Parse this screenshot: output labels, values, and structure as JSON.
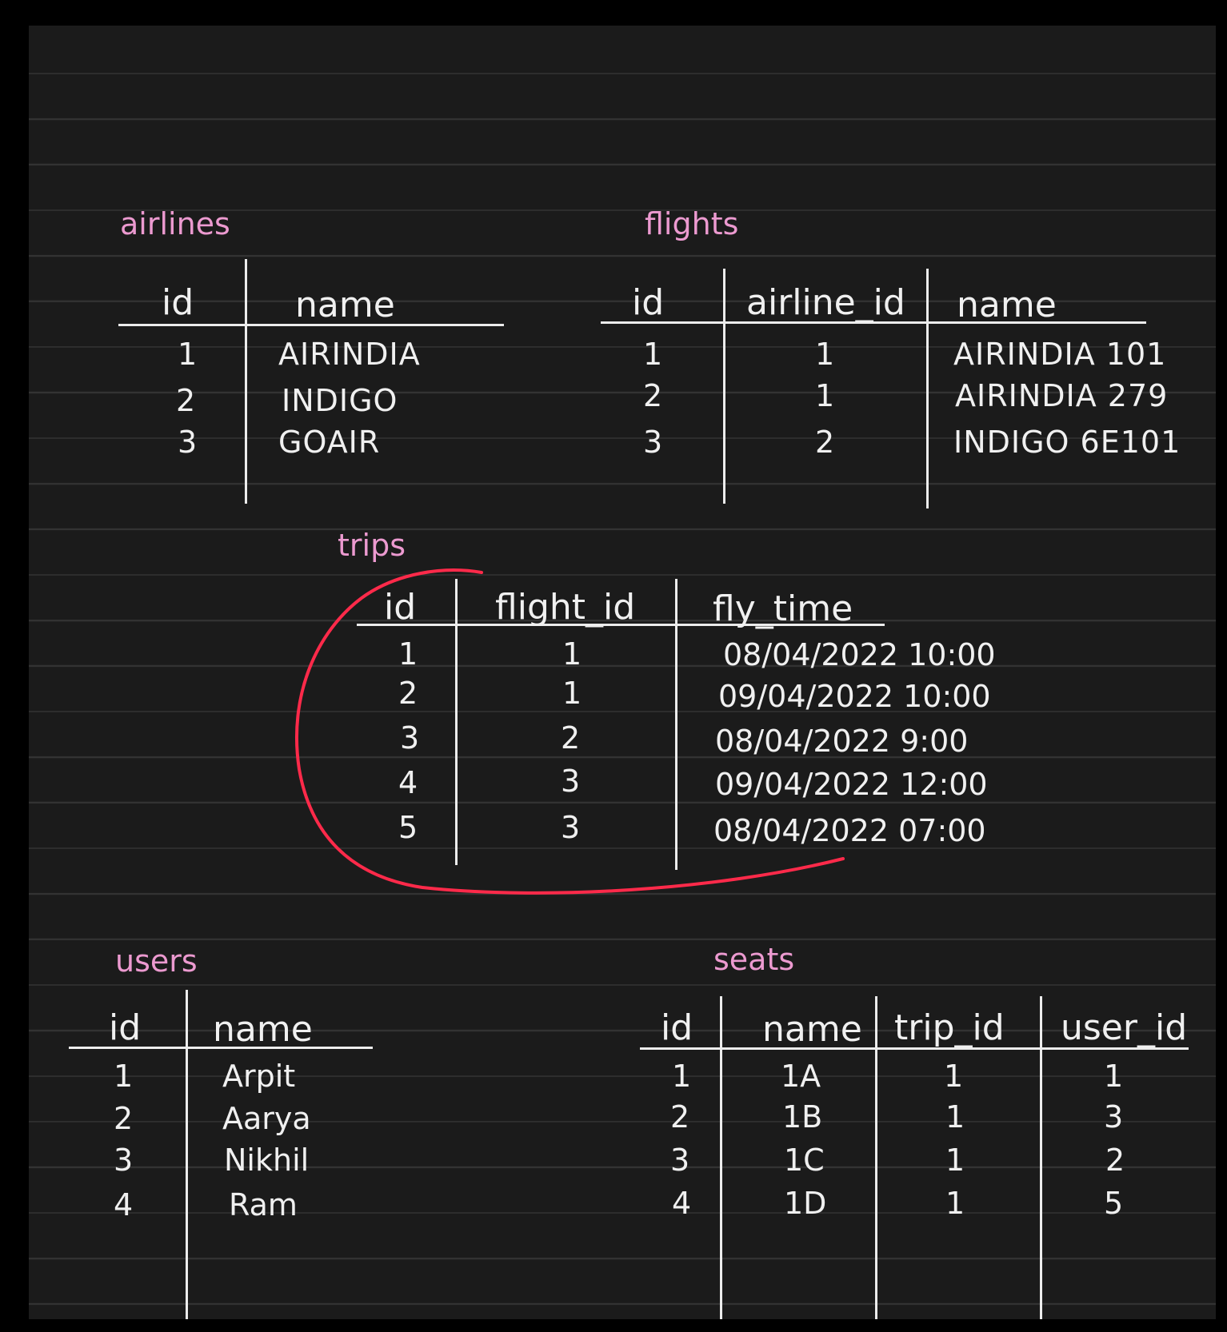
{
  "tables": {
    "airlines": {
      "title": "airlines",
      "columns": [
        "id",
        "name"
      ],
      "rows": [
        [
          "1",
          "AIRINDIA"
        ],
        [
          "2",
          "INDIGO"
        ],
        [
          "3",
          "GOAIR"
        ]
      ]
    },
    "flights": {
      "title": "flights",
      "columns": [
        "id",
        "airline_id",
        "name"
      ],
      "rows": [
        [
          "1",
          "1",
          "AIRINDIA 101"
        ],
        [
          "2",
          "1",
          "AIRINDIA 279"
        ],
        [
          "3",
          "2",
          "INDIGO 6E101"
        ]
      ]
    },
    "trips": {
      "title": "trips",
      "columns": [
        "id",
        "flight_id",
        "fly_time"
      ],
      "rows": [
        [
          "1",
          "1",
          "08/04/2022 10:00"
        ],
        [
          "2",
          "1",
          "09/04/2022 10:00"
        ],
        [
          "3",
          "2",
          "08/04/2022 9:00"
        ],
        [
          "4",
          "3",
          "09/04/2022 12:00"
        ],
        [
          "5",
          "3",
          "08/04/2022 07:00"
        ]
      ]
    },
    "users": {
      "title": "users",
      "columns": [
        "id",
        "name"
      ],
      "rows": [
        [
          "1",
          "Arpit"
        ],
        [
          "2",
          "Aarya"
        ],
        [
          "3",
          "Nikhil"
        ],
        [
          "4",
          "Ram"
        ]
      ]
    },
    "seats": {
      "title": "seats",
      "columns": [
        "id",
        "name",
        "trip_id",
        "user_id"
      ],
      "rows": [
        [
          "1",
          "1A",
          "1",
          "1"
        ],
        [
          "2",
          "1B",
          "1",
          "3"
        ],
        [
          "3",
          "1C",
          "1",
          "2"
        ],
        [
          "4",
          "1D",
          "1",
          "5"
        ]
      ]
    }
  },
  "colors": {
    "background": "#1b1b1b",
    "ruled_line": "#333333",
    "ink": "#f0f0f0",
    "title": "#ec9ad0",
    "highlight": "#ff2a4a"
  }
}
